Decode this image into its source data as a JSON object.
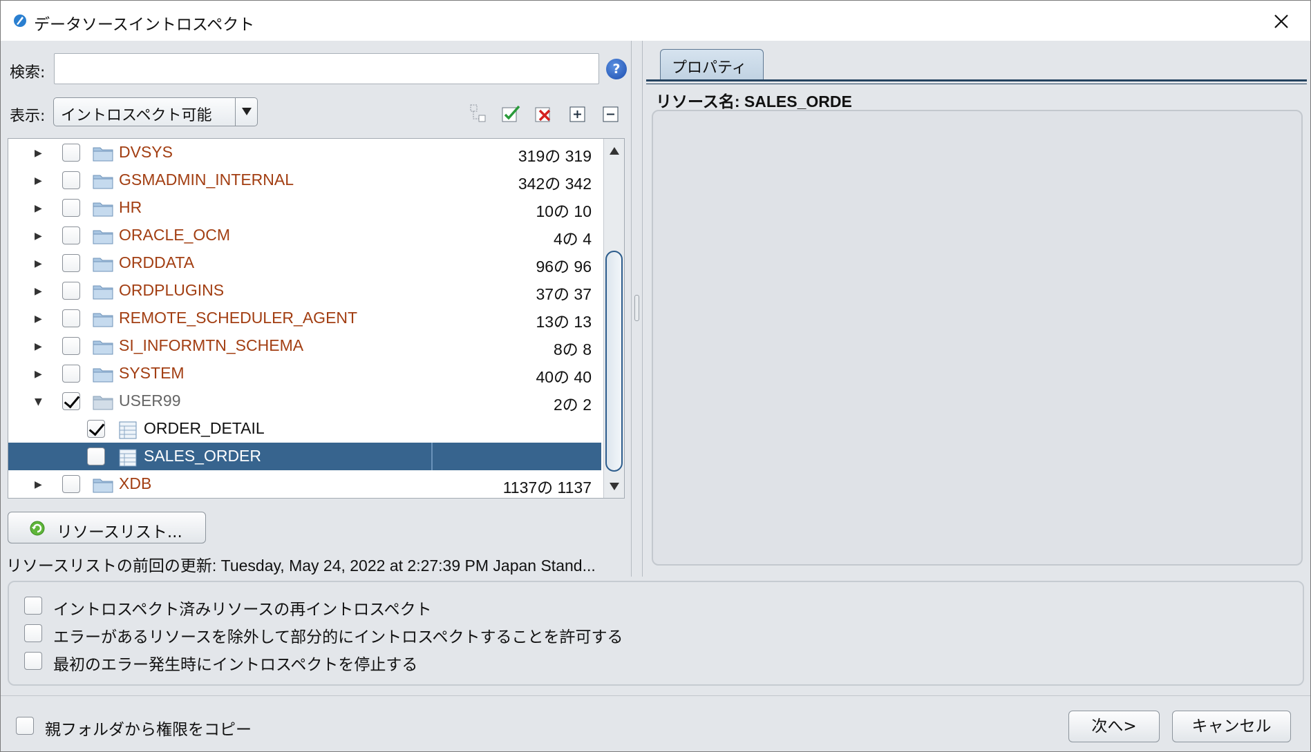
{
  "window": {
    "title": "データソースイントロスペクト"
  },
  "search": {
    "label": "検索:",
    "value": ""
  },
  "view": {
    "label": "表示:",
    "selected": "イントロスペクト可能"
  },
  "toolbar": {
    "icons": [
      "copy-tree-icon",
      "check-all-icon",
      "uncheck-all-icon",
      "expand-all-icon",
      "collapse-all-icon"
    ]
  },
  "tree": {
    "rows": [
      {
        "name": "DVSYS",
        "count": "319の 319",
        "type": "folder",
        "expanded": false,
        "checked": false
      },
      {
        "name": "GSMADMIN_INTERNAL",
        "count": "342の 342",
        "type": "folder",
        "expanded": false,
        "checked": false
      },
      {
        "name": "HR",
        "count": "10の 10",
        "type": "folder",
        "expanded": false,
        "checked": false
      },
      {
        "name": "ORACLE_OCM",
        "count": "4の 4",
        "type": "folder",
        "expanded": false,
        "checked": false
      },
      {
        "name": "ORDDATA",
        "count": "96の 96",
        "type": "folder",
        "expanded": false,
        "checked": false
      },
      {
        "name": "ORDPLUGINS",
        "count": "37の 37",
        "type": "folder",
        "expanded": false,
        "checked": false
      },
      {
        "name": "REMOTE_SCHEDULER_AGENT",
        "count": "13の 13",
        "type": "folder",
        "expanded": false,
        "checked": false
      },
      {
        "name": "SI_INFORMTN_SCHEMA",
        "count": "8の 8",
        "type": "folder",
        "expanded": false,
        "checked": false
      },
      {
        "name": "SYSTEM",
        "count": "40の 40",
        "type": "folder",
        "expanded": false,
        "checked": false
      },
      {
        "name": "USER99",
        "count": "2の 2",
        "type": "folder",
        "expanded": true,
        "checked": true
      },
      {
        "name": "ORDER_DETAIL",
        "count": "",
        "type": "table",
        "checked": true
      },
      {
        "name": "SALES_ORDER",
        "count": "",
        "type": "table",
        "checked": false,
        "selected": true
      },
      {
        "name": "XDB",
        "count": "1137の 1137",
        "type": "folder",
        "expanded": false,
        "checked": false
      }
    ]
  },
  "reload_button": {
    "label": "リソースリスト..."
  },
  "last_update": "リソースリストの前回の更新: Tuesday, May 24, 2022 at 2:27:39 PM Japan Stand...",
  "properties": {
    "tab_label": "プロパティ",
    "resource_name": "リソース名: SALES_ORDE"
  },
  "options": [
    {
      "label": "イントロスペクト済みリソースの再イントロスペクト",
      "checked": false
    },
    {
      "label": "エラーがあるリソースを除外して部分的にイントロスペクトすることを許可する",
      "checked": false
    },
    {
      "label": "最初のエラー発生時にイントロスペクトを停止する",
      "checked": false
    }
  ],
  "copy_permissions": {
    "label": "親フォルダから権限をコピー",
    "checked": false
  },
  "buttons": {
    "next": "次へ>",
    "cancel": "キャンセル"
  },
  "colors": {
    "accent": "#37648e",
    "resource_text": "#a23e12",
    "panel_bg": "#e3e6ea"
  }
}
